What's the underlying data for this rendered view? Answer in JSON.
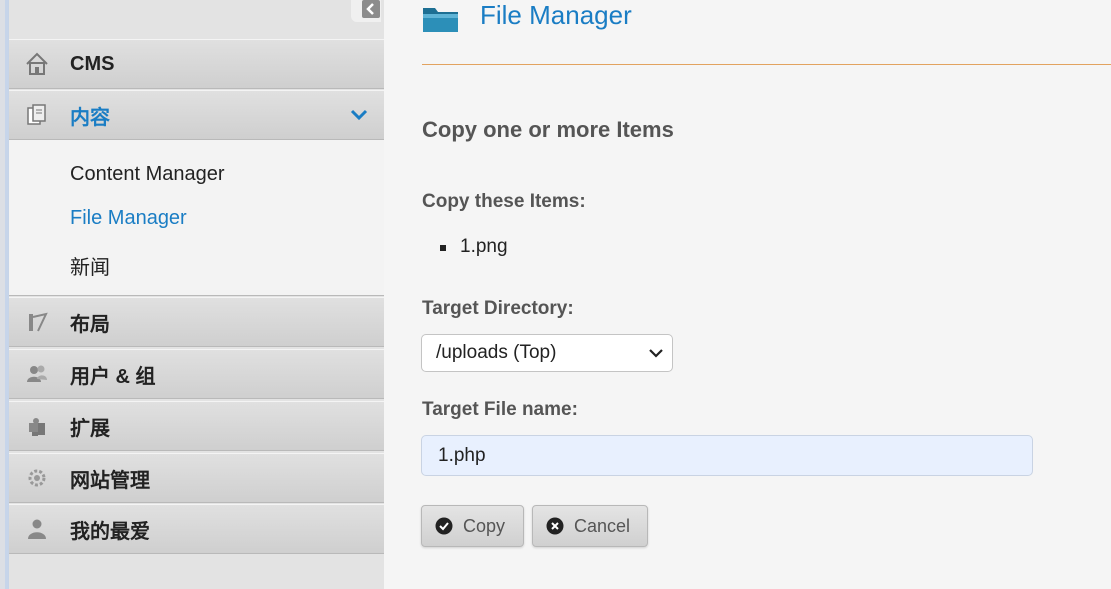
{
  "sidebar": {
    "sections": [
      {
        "label": "CMS",
        "icon": "home-icon"
      },
      {
        "label": "内容",
        "icon": "documents-icon",
        "active": true
      },
      {
        "label": "布局",
        "icon": "layout-icon"
      },
      {
        "label": "用户 & 组",
        "icon": "users-icon"
      },
      {
        "label": "扩展",
        "icon": "puzzle-icon"
      },
      {
        "label": "网站管理",
        "icon": "gear-icon"
      },
      {
        "label": "我的最爱",
        "icon": "user-icon"
      }
    ],
    "submenu": [
      {
        "label": "Content Manager"
      },
      {
        "label": "File Manager",
        "active": true
      },
      {
        "label": "新闻"
      }
    ]
  },
  "main": {
    "title": "File Manager",
    "form_title": "Copy one or more Items",
    "copy_items_label": "Copy these Items:",
    "items": [
      "1.png"
    ],
    "target_dir_label": "Target Directory:",
    "target_dir_value": "/uploads (Top)",
    "target_file_label": "Target File name:",
    "target_file_value": "1.php",
    "copy_button": "Copy",
    "cancel_button": "Cancel"
  },
  "colors": {
    "accent": "#1a7dc4",
    "divider": "#e2a35f"
  }
}
